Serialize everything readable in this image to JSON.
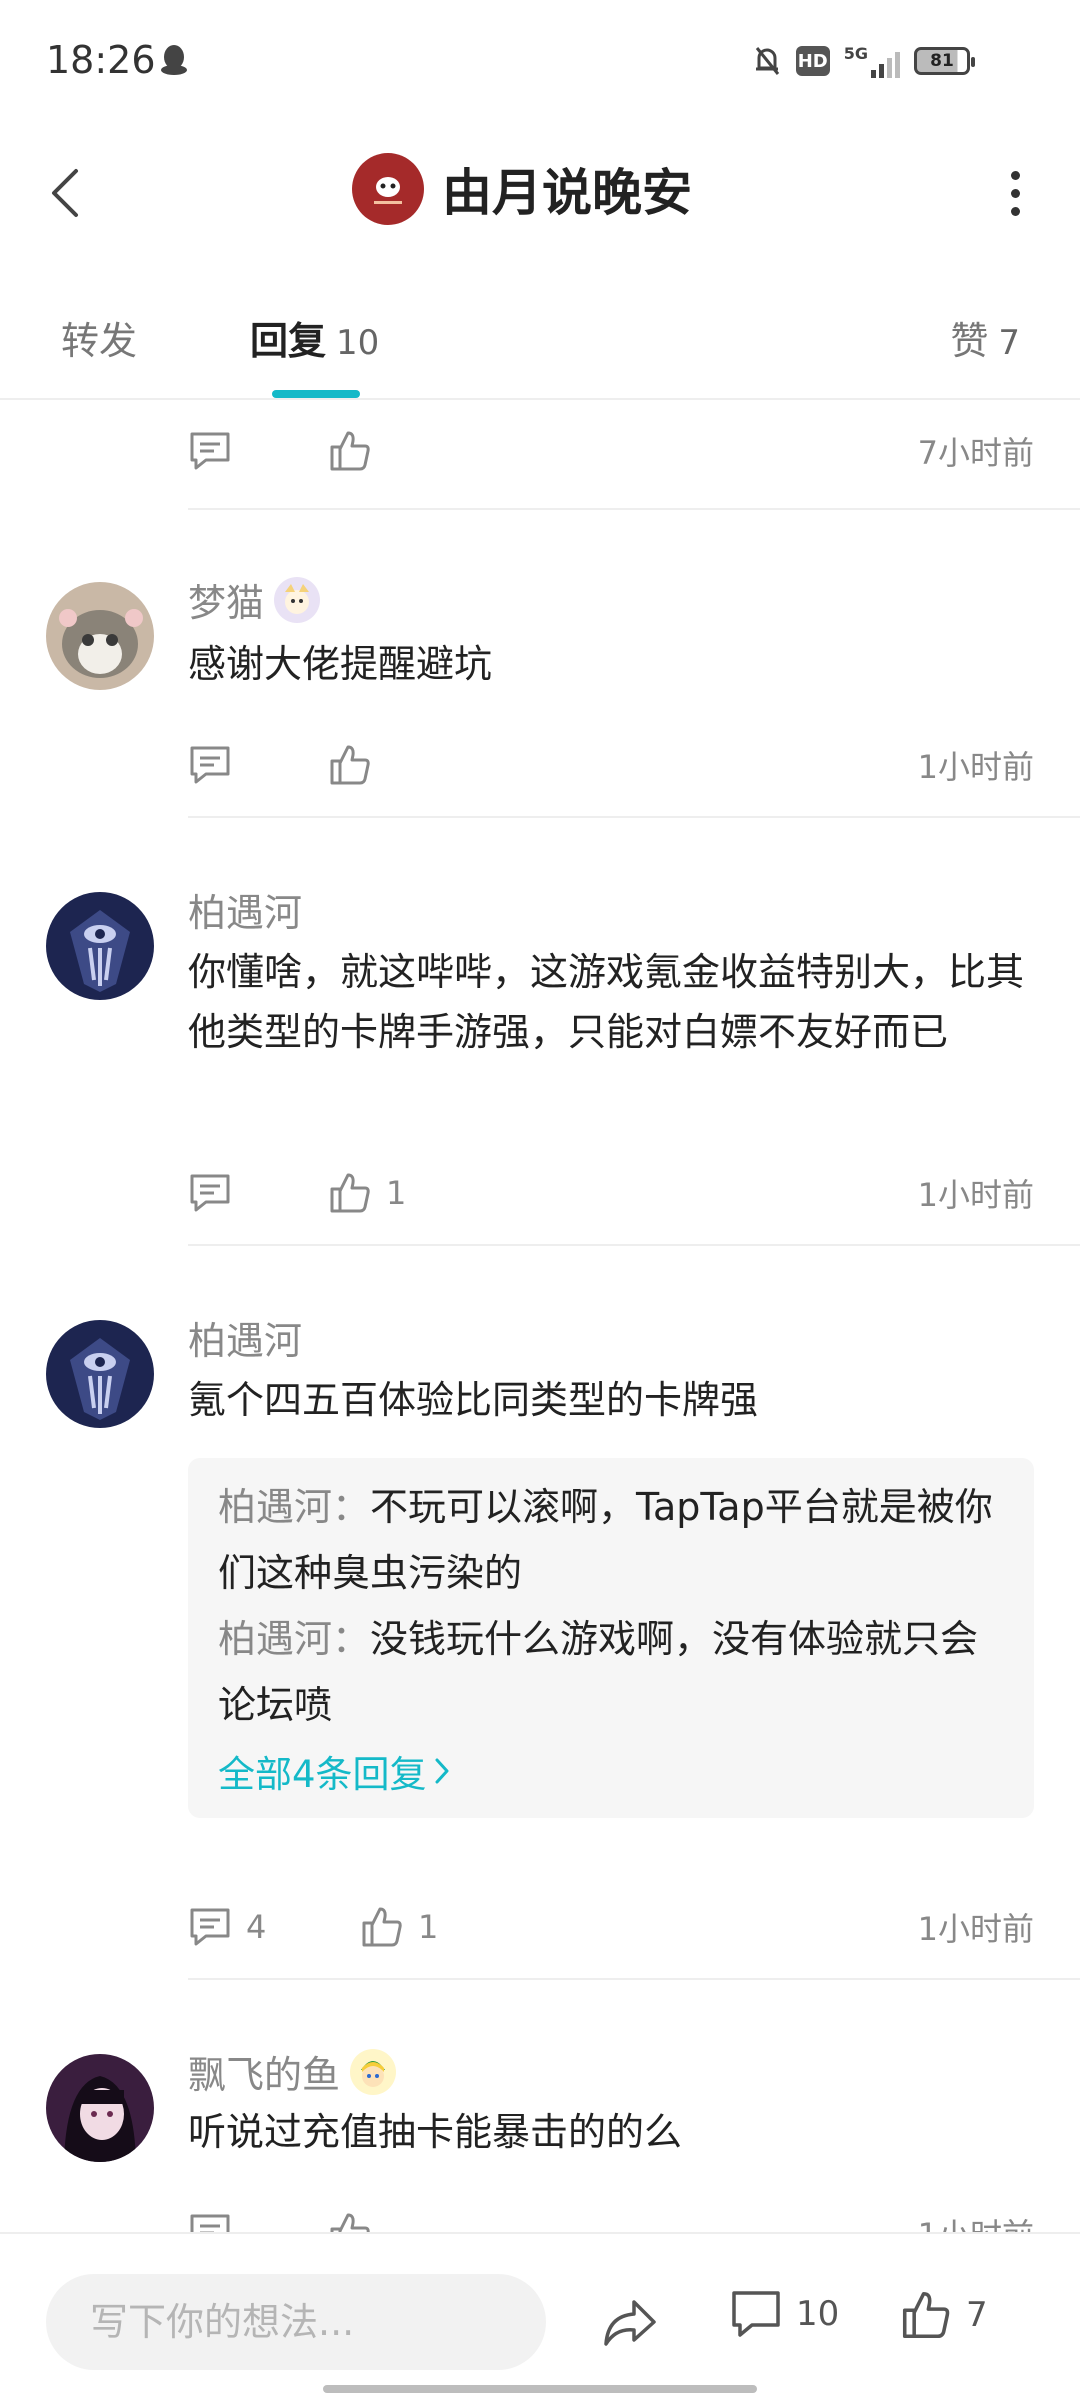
{
  "status_bar": {
    "time": "18:26",
    "icons": [
      "qq-penguin-icon",
      "mute-bell-icon",
      "hd-icon",
      "5g-signal-icon",
      "battery-icon"
    ],
    "hd_label": "HD",
    "network_label": "5G",
    "battery_level": "81"
  },
  "header": {
    "title": "由月说晚安",
    "icons": [
      "back-arrow-icon",
      "more-vertical-icon"
    ]
  },
  "tabs": [
    {
      "label": "转发",
      "count": ""
    },
    {
      "label": "回复",
      "count": "10"
    },
    {
      "label": "赞",
      "count": "7"
    }
  ],
  "accent_color": "#14b9c8",
  "top_partial": {
    "time": "7小时前"
  },
  "comments": [
    {
      "username": "梦猫",
      "text": "感谢大佬提醒避坑",
      "reply_count": "",
      "like_count": "",
      "time": "1小时前"
    },
    {
      "username": "柏遇河",
      "text": "你懂啥，就这哔哔，这游戏氪金收益特别大，比其他类型的卡牌手游强，只能对白嫖不友好而已",
      "reply_count": "",
      "like_count": "1",
      "time": "1小时前"
    },
    {
      "username": "柏遇河",
      "text": "氪个四五百体验比同类型的卡牌强",
      "replies": [
        {
          "name": "柏遇河",
          "sep": "：",
          "text": "不玩可以滚啊，TapTap平台就是被你们这种臭虫污染的"
        },
        {
          "name": "柏遇河",
          "sep": "：",
          "text": "没钱玩什么游戏啊，没有体验就只会论坛喷"
        }
      ],
      "all_replies_label": "全部4条回复",
      "reply_count": "4",
      "like_count": "1",
      "time": "1小时前"
    },
    {
      "username": "飘飞的鱼",
      "text": "听说过充值抽卡能暴击的的么",
      "time": "1小时前"
    }
  ],
  "bottom_bar": {
    "input_placeholder": "写下你的想法...",
    "comment_count": "10",
    "like_count": "7"
  }
}
